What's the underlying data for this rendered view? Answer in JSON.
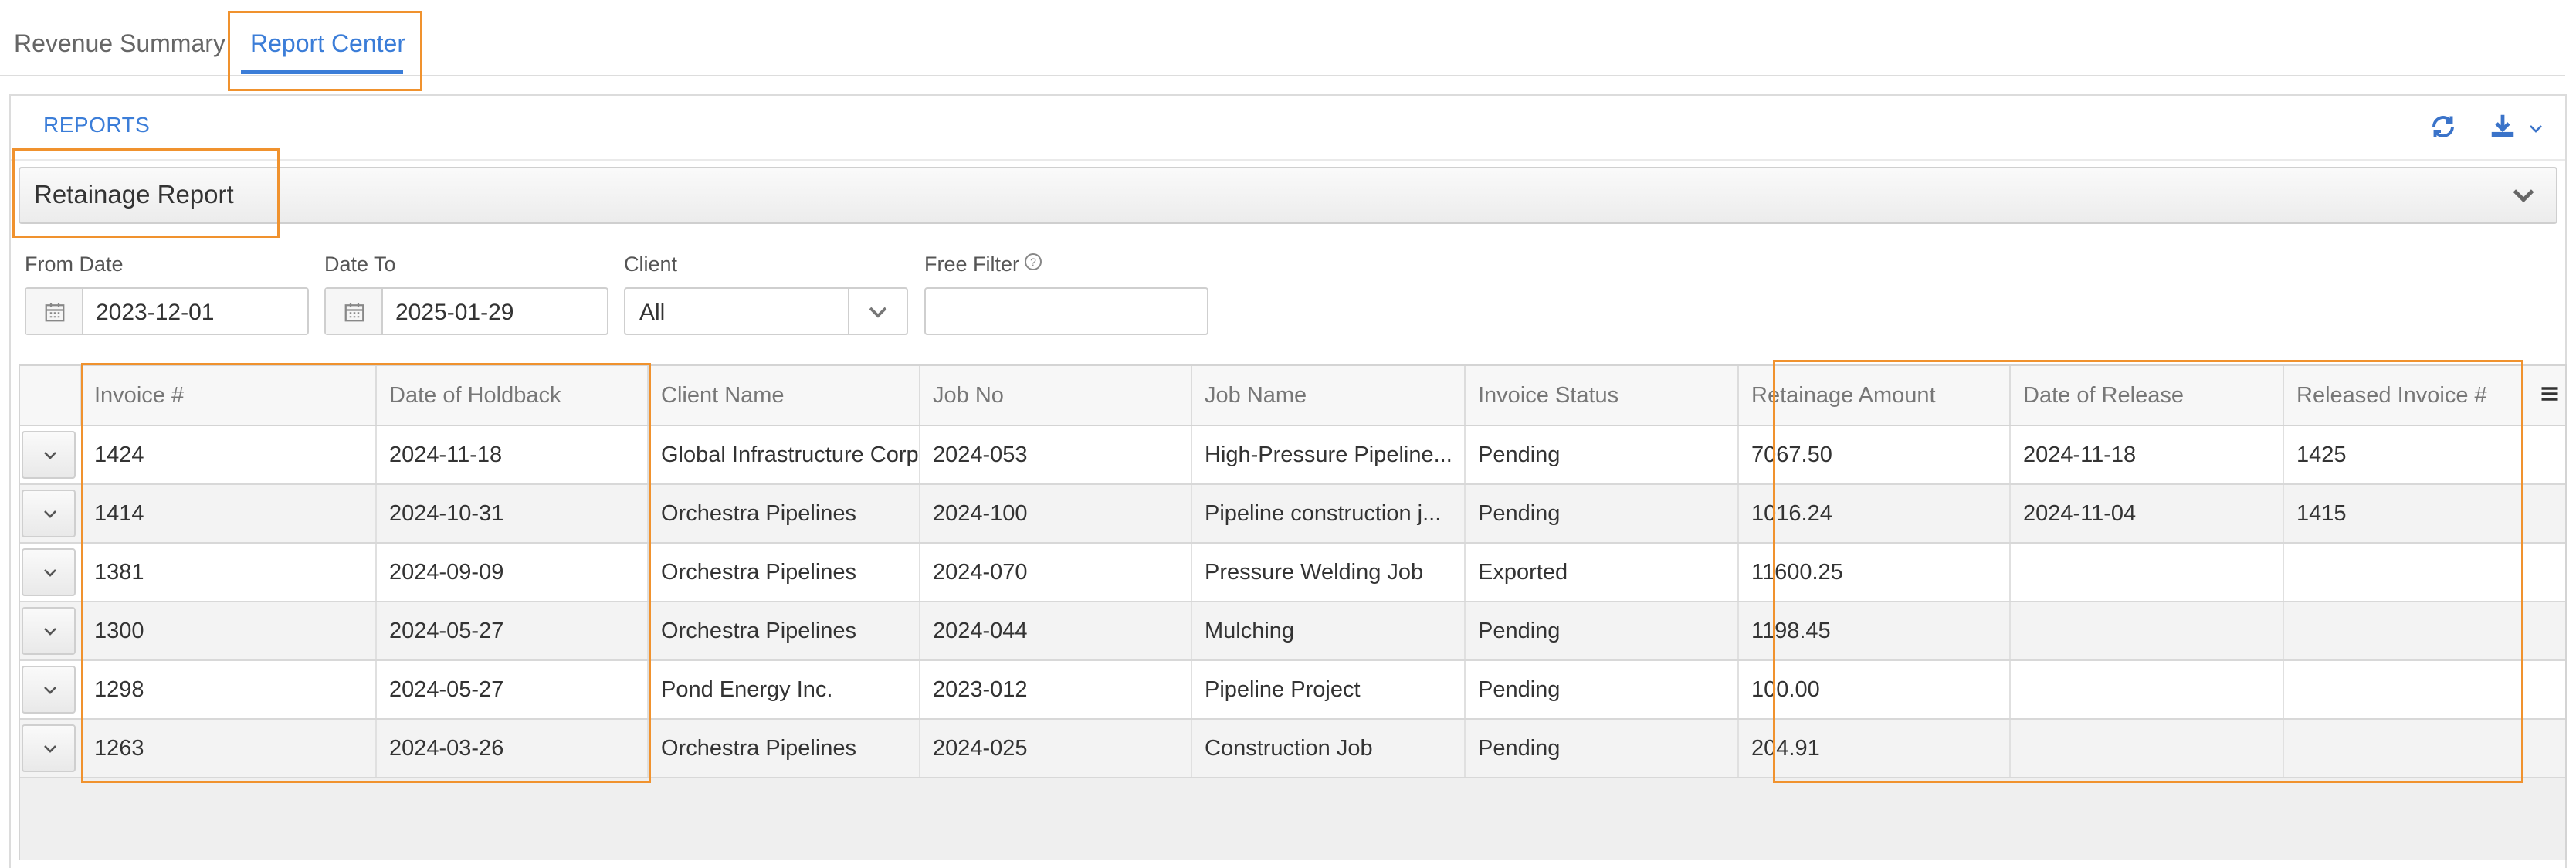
{
  "tabs": [
    {
      "label": "Revenue Summary",
      "active": false
    },
    {
      "label": "Report Center",
      "active": true
    }
  ],
  "panel": {
    "title": "REPORTS",
    "icons": [
      "refresh-icon",
      "download-icon",
      "chevron-down-icon"
    ]
  },
  "report_select": {
    "value": "Retainage Report"
  },
  "filters": {
    "from_date": {
      "label": "From Date",
      "value": "2023-12-01"
    },
    "date_to": {
      "label": "Date To",
      "value": "2025-01-29"
    },
    "client": {
      "label": "Client",
      "value": "All"
    },
    "free_filter": {
      "label": "Free Filter",
      "value": ""
    }
  },
  "table": {
    "columns": [
      "Invoice #",
      "Date of Holdback",
      "Client Name",
      "Job No",
      "Job Name",
      "Invoice Status",
      "Retainage Amount",
      "Date of Release",
      "Released Invoice #"
    ],
    "rows": [
      [
        "1424",
        "2024-11-18",
        "Global Infrastructure Corp.",
        "2024-053",
        "High-Pressure Pipeline...",
        "Pending",
        "7067.50",
        "2024-11-18",
        "1425"
      ],
      [
        "1414",
        "2024-10-31",
        "Orchestra Pipelines",
        "2024-100",
        "Pipeline construction j...",
        "Pending",
        "1016.24",
        "2024-11-04",
        "1415"
      ],
      [
        "1381",
        "2024-09-09",
        "Orchestra Pipelines",
        "2024-070",
        "Pressure Welding Job",
        "Exported",
        "11600.25",
        "",
        ""
      ],
      [
        "1300",
        "2024-05-27",
        "Orchestra Pipelines",
        "2024-044",
        "Mulching",
        "Pending",
        "1198.45",
        "",
        ""
      ],
      [
        "1298",
        "2024-05-27",
        "Pond Energy Inc.",
        "2023-012",
        "Pipeline Project",
        "Pending",
        "100.00",
        "",
        ""
      ],
      [
        "1263",
        "2024-03-26",
        "Orchestra Pipelines",
        "2024-025",
        "Construction Job",
        "Pending",
        "204.91",
        "",
        ""
      ]
    ]
  },
  "colors": {
    "accent": "#3b7dd8",
    "highlight": "#f0922e"
  }
}
